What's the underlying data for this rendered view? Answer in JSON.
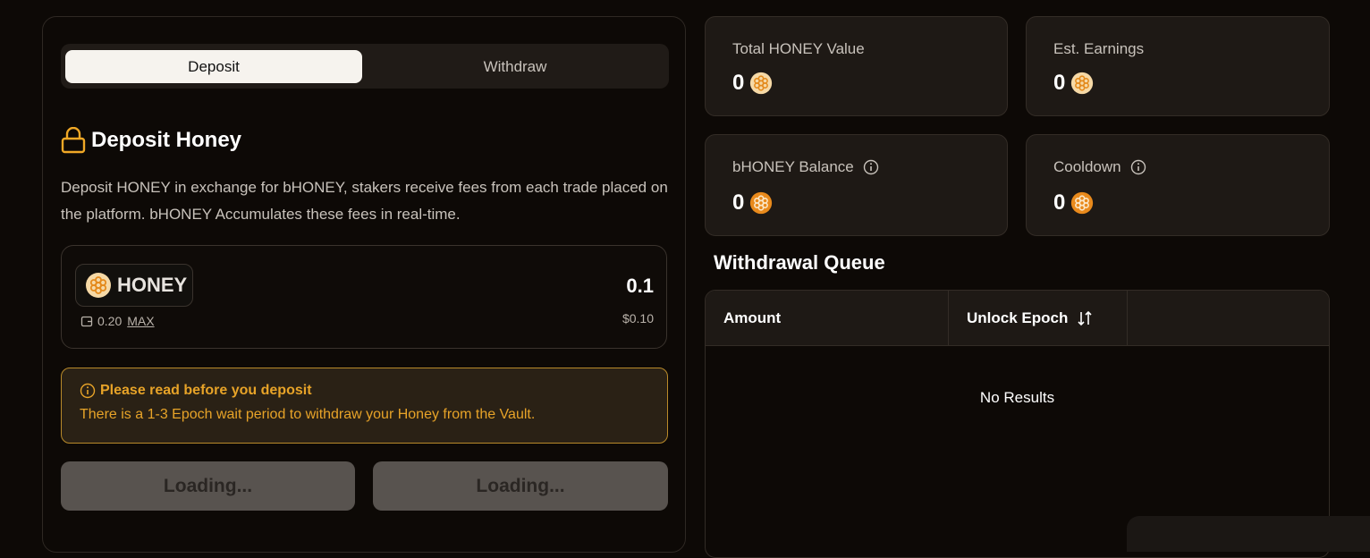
{
  "tabs": {
    "deposit": "Deposit",
    "withdraw": "Withdraw"
  },
  "deposit": {
    "title": "Deposit Honey",
    "description": "Deposit HONEY in exchange for bHONEY, stakers receive fees from each trade placed on the platform. bHONEY Accumulates these fees in real-time.",
    "token": "HONEY",
    "amount": "0.1",
    "usd_value": "$0.10",
    "balance": "0.20",
    "max_label": "MAX"
  },
  "notice": {
    "title": "Please read before you deposit",
    "text": "There is a 1-3 Epoch wait period to withdraw your Honey from the Vault."
  },
  "buttons": {
    "left": "Loading...",
    "right": "Loading..."
  },
  "stats": {
    "total_value": {
      "label": "Total HONEY Value",
      "value": "0"
    },
    "earnings": {
      "label": "Est. Earnings",
      "value": "0"
    },
    "bhoney_balance": {
      "label": "bHONEY Balance",
      "value": "0"
    },
    "cooldown": {
      "label": "Cooldown",
      "value": "0"
    }
  },
  "queue": {
    "title": "Withdrawal Queue",
    "columns": [
      "Amount",
      "Unlock Epoch"
    ],
    "empty": "No Results"
  },
  "colors": {
    "accent": "#e7a328",
    "bg": "#0d0906",
    "card": "#1e1915"
  },
  "icons": [
    "lock-icon",
    "honey-coin-icon",
    "wallet-icon",
    "info-icon",
    "sort-icon"
  ]
}
